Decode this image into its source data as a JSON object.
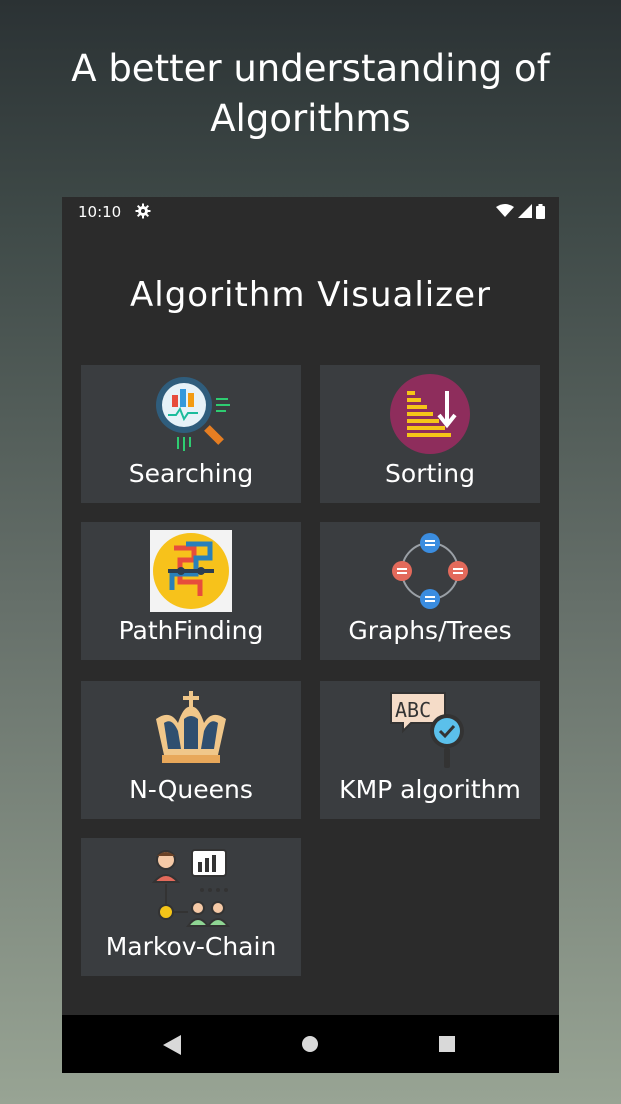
{
  "promo": {
    "title_line1": "A better understanding of",
    "title_line2": "Algorithms"
  },
  "status_bar": {
    "time": "10:10",
    "icons": [
      "gear-icon",
      "wifi-icon",
      "signal-icon",
      "battery-icon"
    ]
  },
  "app": {
    "title": "Algorithm Visualizer"
  },
  "tiles": [
    {
      "label": "Searching",
      "icon": "magnifier-chart-icon"
    },
    {
      "label": "Sorting",
      "icon": "sorting-bars-icon"
    },
    {
      "label": "PathFinding",
      "icon": "path-icon"
    },
    {
      "label": "Graphs/Trees",
      "icon": "graph-nodes-icon"
    },
    {
      "label": "N-Queens",
      "icon": "crown-icon"
    },
    {
      "label": "KMP algorithm",
      "icon": "abc-magnifier-icon"
    },
    {
      "label": "Markov-Chain",
      "icon": "people-network-icon"
    }
  ],
  "nav_bar": {
    "icons": [
      "back-icon",
      "home-icon",
      "recents-icon"
    ]
  },
  "colors": {
    "phone_bg": "#2b2b2b",
    "tile_bg": "#3a3d40",
    "nav_bg": "#000000"
  }
}
